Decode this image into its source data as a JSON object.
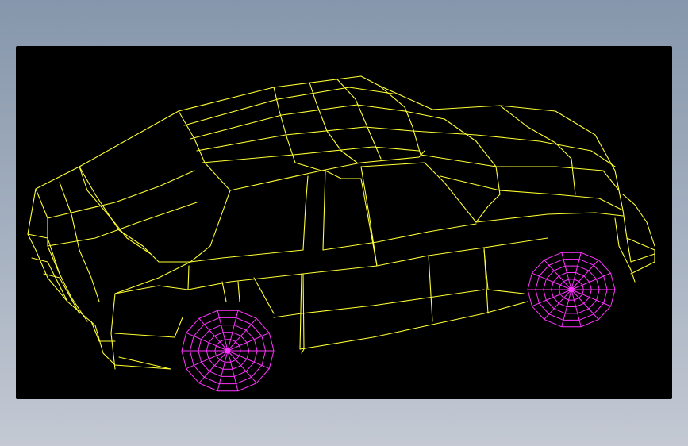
{
  "canvas": {
    "background_color": "#8a9bb0",
    "viewport_color": "#000000"
  },
  "model": {
    "render_mode": "wireframe",
    "body_color": "#ffff33",
    "wheel_color": "#ff33ff",
    "body_icon": "car-body-wireframe-icon",
    "wheel_icon": "wheel-wireframe-icon"
  }
}
